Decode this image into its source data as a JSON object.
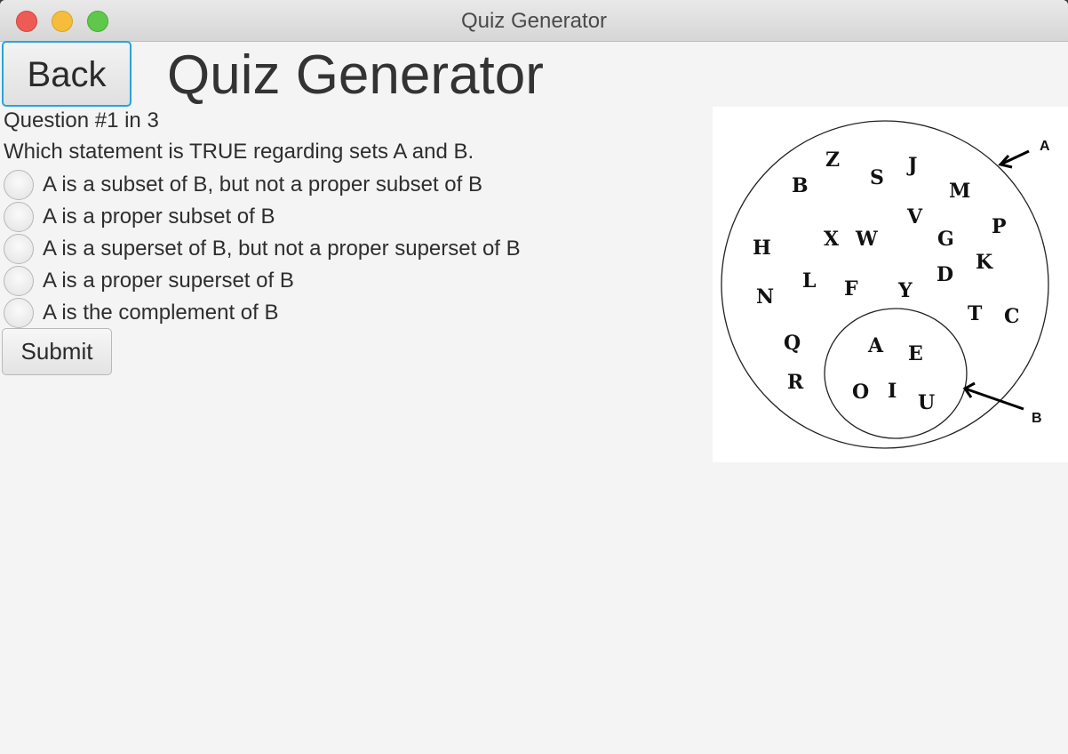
{
  "window": {
    "title": "Quiz Generator"
  },
  "header": {
    "back_label": "Back",
    "title": "Quiz Generator"
  },
  "question": {
    "number_text": "Question #1 in 3",
    "text": "Which statement is TRUE regarding sets A and B.",
    "options": [
      "A is a subset of B, but not a proper subset of B",
      "A is a proper subset of B",
      "A is a superset of B, but not a proper superset of B",
      "A is a proper superset of B",
      "A is the complement of B"
    ],
    "selected_index": null
  },
  "submit_label": "Submit",
  "diagram": {
    "outer_set_label": "A",
    "inner_set_label": "B",
    "outer_letters": [
      "Z",
      "S",
      "J",
      "B",
      "M",
      "V",
      "P",
      "H",
      "X",
      "W",
      "G",
      "K",
      "D",
      "L",
      "F",
      "Y",
      "N",
      "T",
      "C",
      "Q",
      "R"
    ],
    "inner_letters": [
      "A",
      "E",
      "O",
      "I",
      "U"
    ]
  },
  "colors": {
    "focus_accent": "#29a3dd",
    "window_bg": "#f4f4f4"
  }
}
